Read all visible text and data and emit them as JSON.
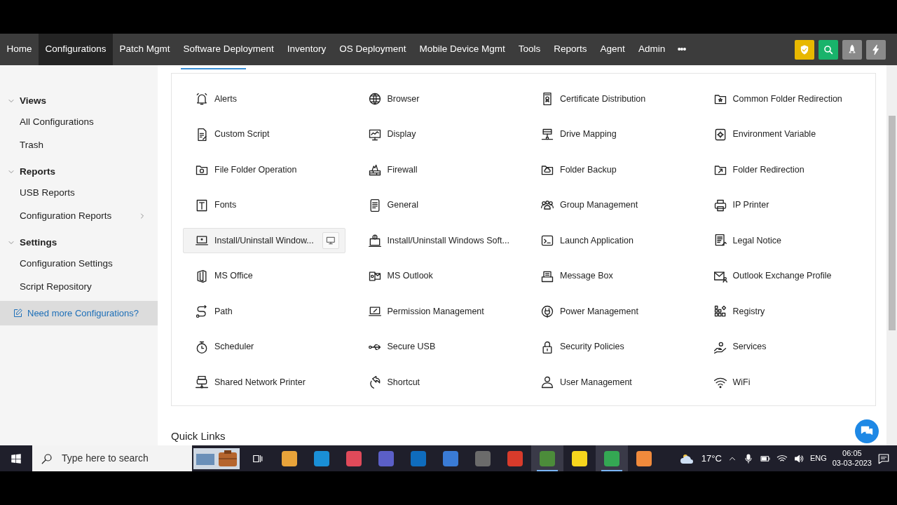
{
  "nav": {
    "items": [
      {
        "label": "Home",
        "selected": false
      },
      {
        "label": "Configurations",
        "selected": true
      },
      {
        "label": "Patch Mgmt",
        "selected": false
      },
      {
        "label": "Software Deployment",
        "selected": false
      },
      {
        "label": "Inventory",
        "selected": false
      },
      {
        "label": "OS Deployment",
        "selected": false
      },
      {
        "label": "Mobile Device Mgmt",
        "selected": false
      },
      {
        "label": "Tools",
        "selected": false
      },
      {
        "label": "Reports",
        "selected": false
      },
      {
        "label": "Agent",
        "selected": false
      },
      {
        "label": "Admin",
        "selected": false
      }
    ],
    "more": "•••"
  },
  "sidebar": {
    "sections": [
      {
        "title": "Views",
        "expanded": true,
        "items": [
          {
            "label": "All Configurations",
            "has_submenu": false
          },
          {
            "label": "Trash",
            "has_submenu": false
          }
        ]
      },
      {
        "title": "Reports",
        "expanded": true,
        "items": [
          {
            "label": "USB Reports",
            "has_submenu": false
          },
          {
            "label": "Configuration Reports",
            "has_submenu": true
          }
        ]
      },
      {
        "title": "Settings",
        "expanded": true,
        "items": [
          {
            "label": "Configuration Settings",
            "has_submenu": false
          },
          {
            "label": "Script Repository",
            "has_submenu": false
          }
        ]
      }
    ],
    "link": "Need more Configurations?"
  },
  "configurations": [
    {
      "label": "Alerts",
      "highlighted": false
    },
    {
      "label": "Browser",
      "highlighted": false
    },
    {
      "label": "Certificate Distribution",
      "highlighted": false
    },
    {
      "label": "Common Folder Redirection",
      "highlighted": false
    },
    {
      "label": "Custom Script",
      "highlighted": false
    },
    {
      "label": "Display",
      "highlighted": false
    },
    {
      "label": "Drive Mapping",
      "highlighted": false
    },
    {
      "label": "Environment Variable",
      "highlighted": false
    },
    {
      "label": "File Folder Operation",
      "highlighted": false
    },
    {
      "label": "Firewall",
      "highlighted": false
    },
    {
      "label": "Folder Backup",
      "highlighted": false
    },
    {
      "label": "Folder Redirection",
      "highlighted": false
    },
    {
      "label": "Fonts",
      "highlighted": false
    },
    {
      "label": "General",
      "highlighted": false
    },
    {
      "label": "Group Management",
      "highlighted": false
    },
    {
      "label": "IP Printer",
      "highlighted": false
    },
    {
      "label": "Install/Uninstall Window...",
      "highlighted": true
    },
    {
      "label": "Install/Uninstall Windows Soft...",
      "highlighted": false
    },
    {
      "label": "Launch Application",
      "highlighted": false
    },
    {
      "label": "Legal Notice",
      "highlighted": false
    },
    {
      "label": "MS Office",
      "highlighted": false
    },
    {
      "label": "MS Outlook",
      "highlighted": false
    },
    {
      "label": "Message Box",
      "highlighted": false
    },
    {
      "label": "Outlook Exchange Profile",
      "highlighted": false
    },
    {
      "label": "Path",
      "highlighted": false
    },
    {
      "label": "Permission Management",
      "highlighted": false
    },
    {
      "label": "Power Management",
      "highlighted": false
    },
    {
      "label": "Registry",
      "highlighted": false
    },
    {
      "label": "Scheduler",
      "highlighted": false
    },
    {
      "label": "Secure USB",
      "highlighted": false
    },
    {
      "label": "Security Policies",
      "highlighted": false
    },
    {
      "label": "Services",
      "highlighted": false
    },
    {
      "label": "Shared Network Printer",
      "highlighted": false
    },
    {
      "label": "Shortcut",
      "highlighted": false
    },
    {
      "label": "User Management",
      "highlighted": false
    },
    {
      "label": "WiFi",
      "highlighted": false
    }
  ],
  "quick_links": {
    "title": "Quick Links"
  },
  "taskbar": {
    "search_placeholder": "Type here to search",
    "apps": [
      {
        "color": "#e8a33a",
        "active": false
      },
      {
        "color": "#1a8fd6",
        "active": false
      },
      {
        "color": "#e04a5a",
        "active": false
      },
      {
        "color": "#5b5fc7",
        "active": false
      },
      {
        "color": "#0f6cbd",
        "active": false
      },
      {
        "color": "#3a7bd5",
        "active": false
      },
      {
        "color": "#6b6b6b",
        "active": false
      },
      {
        "color": "#d83b2b",
        "active": false
      },
      {
        "color": "#4c8c3a",
        "active": true
      },
      {
        "color": "#f7d51d",
        "active": false
      },
      {
        "color": "#34a853",
        "active": true
      },
      {
        "color": "#f08a3c",
        "active": false
      }
    ],
    "temperature": "17°C",
    "language": "ENG",
    "time": "06:05",
    "date": "03-03-2023"
  }
}
